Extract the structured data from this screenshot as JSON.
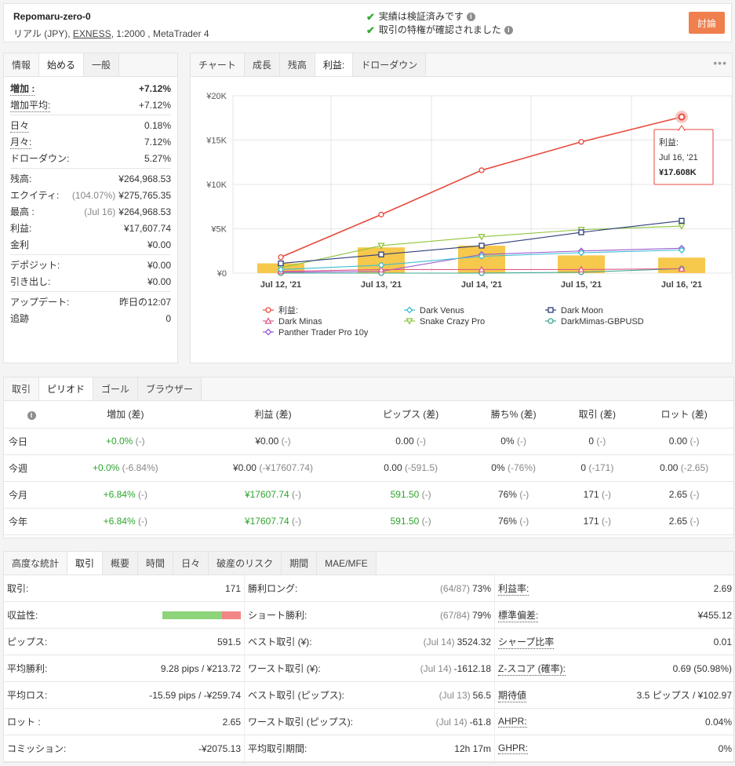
{
  "header": {
    "account_name": "Repomaru-zero-0",
    "type": "リアル (JPY), ",
    "broker": "EXNESS",
    "details": ", 1:2000 , MetaTrader 4",
    "verify1": "実績は検証済みです",
    "verify2": "取引の特権が確認されました",
    "discuss_label": "討論"
  },
  "info": {
    "tabs": [
      "情報",
      "始める",
      "一般"
    ],
    "gain_label": "増加 :",
    "gain_value": "+7.12%",
    "absgain_label": "増加平均:",
    "absgain_value": "+7.12%",
    "daily_label": "日々",
    "daily_value": "0.18%",
    "monthly_label": "月々:",
    "monthly_value": "7.12%",
    "drawdown_label": "ドローダウン:",
    "drawdown_value": "5.27%",
    "balance_label": "残高:",
    "balance_value": "¥264,968.53",
    "equity_label": "エクイティ:",
    "equity_pct": "(104.07%)",
    "equity_value": "¥275,765.35",
    "highest_label": "最高 :",
    "highest_date": "(Jul 16)",
    "highest_value": "¥264,968.53",
    "profit_label": "利益:",
    "profit_value": "¥17,607.74",
    "interest_label": "金利",
    "interest_value": "¥0.00",
    "deposits_label": "デポジット:",
    "deposits_value": "¥0.00",
    "withdrawals_label": "引き出し:",
    "withdrawals_value": "¥0.00",
    "updated_label": "アップデート:",
    "updated_value": "昨日の12:07",
    "tracking_label": "追跡",
    "tracking_value": "0"
  },
  "chart_tabs": [
    "チャート",
    "成長",
    "残高",
    "利益:",
    "ドローダウン"
  ],
  "chart_data": {
    "type": "line",
    "x": [
      "Jul 12, '21",
      "Jul 13, '21",
      "Jul 14, '21",
      "Jul 15, '21",
      "Jul 16, '21"
    ],
    "yticks": [
      "¥0",
      "¥5K",
      "¥10K",
      "¥15K",
      "¥20K"
    ],
    "ylim": [
      0,
      20000
    ],
    "bars": [
      1100,
      2900,
      3100,
      2000,
      1750
    ],
    "series": [
      {
        "name": "利益:",
        "color": "#e8493d",
        "marker": "circle",
        "values": [
          1800,
          6600,
          11600,
          14800,
          17608
        ]
      },
      {
        "name": "Dark Venus",
        "color": "#3cbfd0",
        "marker": "diamond",
        "values": [
          400,
          900,
          1900,
          2300,
          2600
        ]
      },
      {
        "name": "Dark Moon",
        "color": "#2e3d7c",
        "marker": "square",
        "values": [
          1100,
          2100,
          3100,
          4600,
          5900
        ]
      },
      {
        "name": "Dark Minas",
        "color": "#e05a8a",
        "marker": "triangle",
        "values": [
          200,
          400,
          400,
          400,
          500
        ]
      },
      {
        "name": "Snake Crazy Pro",
        "color": "#8fc43c",
        "marker": "triangle-down",
        "values": [
          600,
          3100,
          4100,
          4900,
          5300
        ]
      },
      {
        "name": "DarkMimas-GBPUSD",
        "color": "#38a890",
        "marker": "circle",
        "values": [
          0,
          0,
          0,
          100,
          500
        ]
      },
      {
        "name": "Panther Trader Pro 10y",
        "color": "#9b59d0",
        "marker": "diamond",
        "values": [
          100,
          200,
          2100,
          2500,
          2800
        ]
      }
    ],
    "tooltip": {
      "label": "利益:",
      "date": "Jul 16, '21",
      "value": "¥17.608K"
    }
  },
  "period": {
    "tabs": [
      "取引",
      "ピリオド",
      "ゴール",
      "ブラウザー"
    ],
    "headers": [
      "増加 (差)",
      "利益 (差)",
      "ピップス (差)",
      "勝ち% (差)",
      "取引 (差)",
      "ロット (差)"
    ],
    "rows": [
      {
        "label": "今日",
        "gain": "+0.0%",
        "gain_d": "(-)",
        "profit": "¥0.00",
        "profit_d": "(-)",
        "pips": "0.00",
        "pips_d": "(-)",
        "win": "0%",
        "win_d": "(-)",
        "trades": "0",
        "trades_d": "(-)",
        "lots": "0.00",
        "lots_d": "(-)"
      },
      {
        "label": "今週",
        "gain": "+0.0%",
        "gain_d": "(-6.84%)",
        "profit": "¥0.00",
        "profit_d": "(-¥17607.74)",
        "pips": "0.00",
        "pips_d": "(-591.5)",
        "win": "0%",
        "win_d": "(-76%)",
        "trades": "0",
        "trades_d": "(-171)",
        "lots": "0.00",
        "lots_d": "(-2.65)"
      },
      {
        "label": "今月",
        "gain": "+6.84%",
        "gain_d": "(-)",
        "profit": "¥17607.74",
        "profit_d": "(-)",
        "pips": "591.50",
        "pips_d": "(-)",
        "win": "76%",
        "win_d": "(-)",
        "trades": "171",
        "trades_d": "(-)",
        "lots": "2.65",
        "lots_d": "(-)"
      },
      {
        "label": "今年",
        "gain": "+6.84%",
        "gain_d": "(-)",
        "profit": "¥17607.74",
        "profit_d": "(-)",
        "pips": "591.50",
        "pips_d": "(-)",
        "win": "76%",
        "win_d": "(-)",
        "trades": "171",
        "trades_d": "(-)",
        "lots": "2.65",
        "lots_d": "(-)"
      }
    ]
  },
  "advanced": {
    "tabs": [
      "高度な統計",
      "取引",
      "概要",
      "時間",
      "日々",
      "破産のリスク",
      "期間",
      "MAE/MFE"
    ],
    "col1": [
      {
        "k": "取引:",
        "v": "171"
      },
      {
        "k": "収益性:",
        "v": "",
        "bar": 0.76
      },
      {
        "k": "ピップス:",
        "v": "591.5"
      },
      {
        "k": "平均勝利:",
        "v": "9.28 pips / ¥213.72"
      },
      {
        "k": "平均ロス:",
        "v": "-15.59 pips / -¥259.74"
      },
      {
        "k": "ロット :",
        "v": "2.65"
      },
      {
        "k": "コミッション:",
        "v": "-¥2075.13"
      }
    ],
    "col2": [
      {
        "k": "勝利ロング:",
        "m": "(64/87)",
        "v": "73%"
      },
      {
        "k": "ショート勝利:",
        "m": "(67/84)",
        "v": "79%"
      },
      {
        "k": "ベスト取引 (¥):",
        "m": "(Jul 14)",
        "v": "3524.32"
      },
      {
        "k": "ワースト取引 (¥):",
        "m": "(Jul 14)",
        "v": "-1612.18"
      },
      {
        "k": "ベスト取引 (ピップス):",
        "m": "(Jul 13)",
        "v": "56.5"
      },
      {
        "k": "ワースト取引 (ピップス):",
        "m": "(Jul 14)",
        "v": "-61.8"
      },
      {
        "k": "平均取引期間:",
        "m": "",
        "v": "12h 17m"
      }
    ],
    "col3": [
      {
        "k": "利益率:",
        "v": "2.69"
      },
      {
        "k": "標準偏差:",
        "v": "¥455.12"
      },
      {
        "k": "シャープ比率",
        "v": "0.01"
      },
      {
        "k": "Z-スコア (確率):",
        "v": "0.69 (50.98%)"
      },
      {
        "k": "期待値",
        "v": "3.5 ピップス / ¥102.97"
      },
      {
        "k": "AHPR:",
        "v": "0.04%"
      },
      {
        "k": "GHPR:",
        "v": "0%"
      }
    ]
  }
}
